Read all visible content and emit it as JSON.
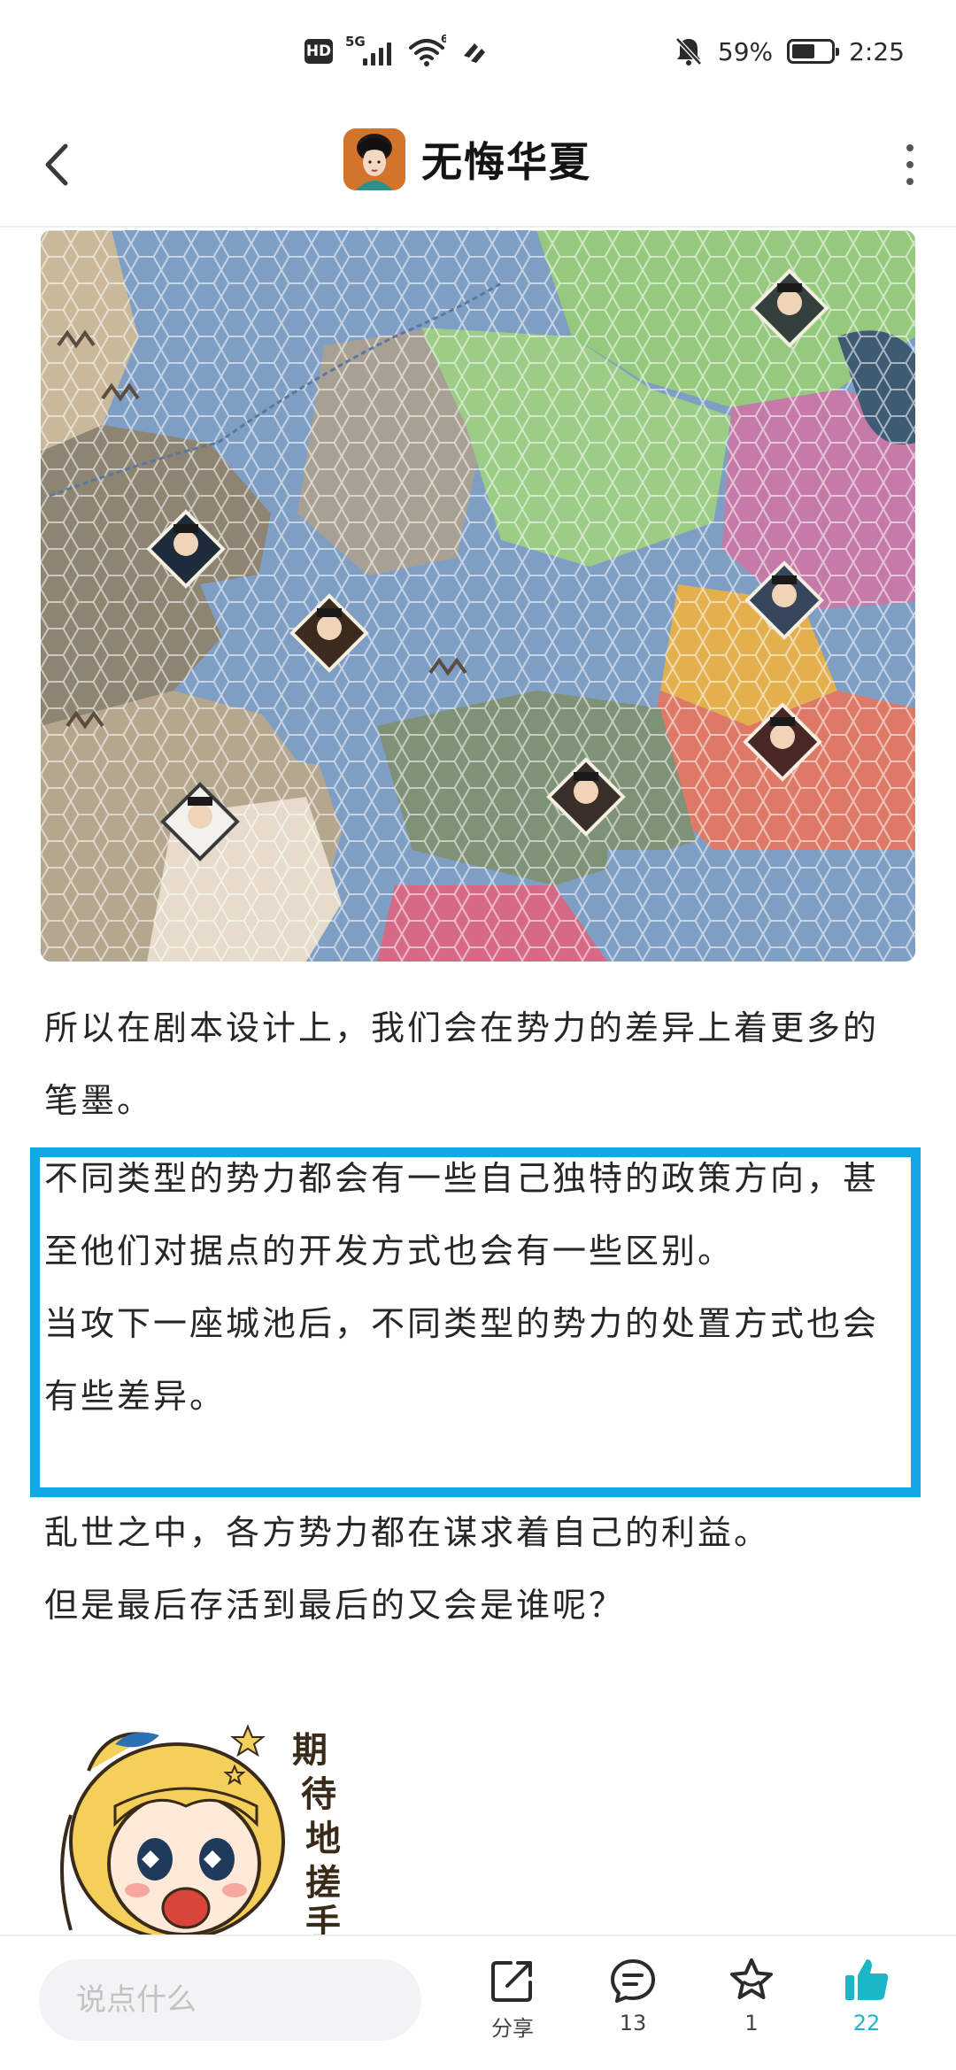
{
  "status_bar": {
    "hd": "HD",
    "network_gen": "5G",
    "wifi_gen": "6",
    "battery_percent": "59%",
    "battery_level": 0.59,
    "time": "2:25"
  },
  "header": {
    "title": "无悔华夏"
  },
  "article": {
    "paragraph_1": "所以在剧本设计上，我们会在势力的差异上着更多的笔墨。",
    "highlighted_paragraph_1": "不同类型的势力都会有一些自己独特的政策方向，甚至他们对据点的开发方式也会有一些区别。",
    "highlighted_paragraph_2": "当攻下一座城池后，不同类型的势力的处置方式也会有些差异。",
    "paragraph_4": "乱世之中，各方势力都在谋求着自己的利益。",
    "paragraph_5": "但是最后存活到最后的又会是谁呢？",
    "sticker_text": "期待地搓手"
  },
  "bottom_bar": {
    "comment_placeholder": "说点什么",
    "share_label": "分享",
    "comment_count": "13",
    "favorite_count": "1",
    "like_count": "22",
    "like_color": "#1bb7c7"
  },
  "colors": {
    "highlight_border": "#14a7e8"
  }
}
